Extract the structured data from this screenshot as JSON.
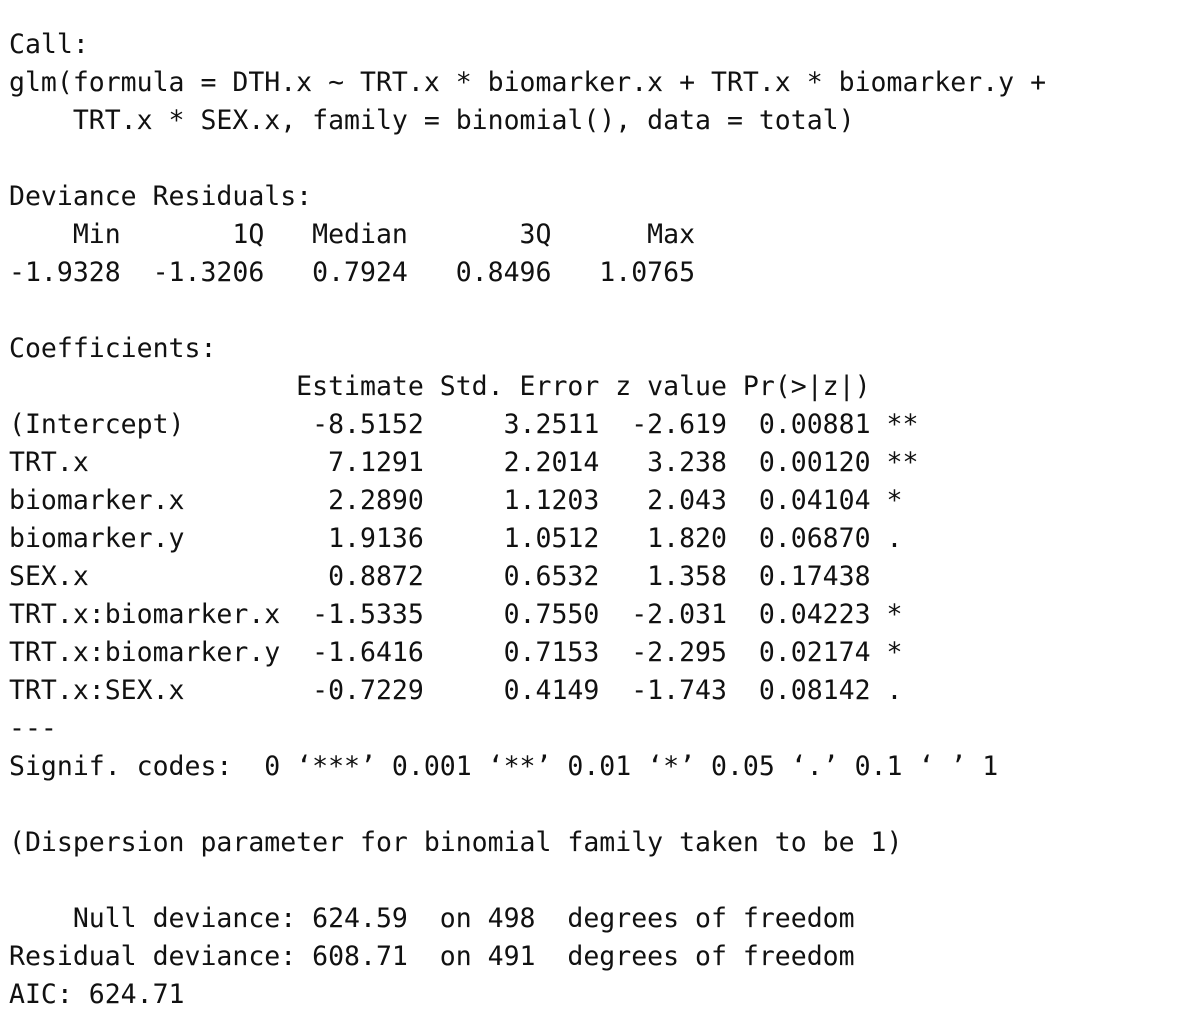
{
  "output": {
    "lines": [
      "Call:",
      "glm(formula = DTH.x ~ TRT.x * biomarker.x + TRT.x * biomarker.y + ",
      "    TRT.x * SEX.x, family = binomial(), data = total)",
      "",
      "Deviance Residuals: ",
      "    Min       1Q   Median       3Q      Max  ",
      "-1.9328  -1.3206   0.7924   0.8496   1.0765  ",
      "",
      "Coefficients:",
      "                  Estimate Std. Error z value Pr(>|z|)   ",
      "(Intercept)        -8.5152     3.2511  -2.619  0.00881 **",
      "TRT.x               7.1291     2.2014   3.238  0.00120 **",
      "biomarker.x         2.2890     1.1203   2.043  0.04104 * ",
      "biomarker.y         1.9136     1.0512   1.820  0.06870 . ",
      "SEX.x               0.8872     0.6532   1.358  0.17438   ",
      "TRT.x:biomarker.x  -1.5335     0.7550  -2.031  0.04223 * ",
      "TRT.x:biomarker.y  -1.6416     0.7153  -2.295  0.02174 * ",
      "TRT.x:SEX.x        -0.7229     0.4149  -1.743  0.08142 . ",
      "---",
      "Signif. codes:  0 ‘***’ 0.001 ‘**’ 0.01 ‘*’ 0.05 ‘.’ 0.1 ‘ ’ 1",
      "",
      "(Dispersion parameter for binomial family taken to be 1)",
      "",
      "    Null deviance: 624.59  on 498  degrees of freedom",
      "Residual deviance: 608.71  on 491  degrees of freedom",
      "AIC: 624.71"
    ]
  }
}
